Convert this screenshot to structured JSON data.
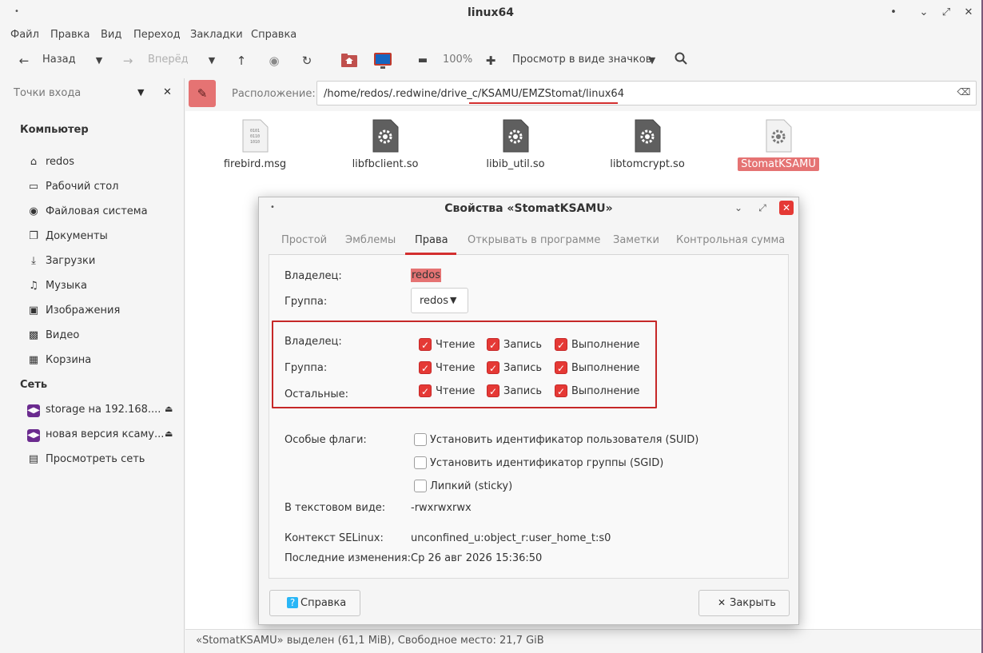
{
  "window": {
    "title": "linux64",
    "controls": {
      "keep_above": "•",
      "menu": "˅",
      "minimize": "˅",
      "maximize": "˄",
      "close": "✕"
    }
  },
  "menubar": [
    "Файл",
    "Правка",
    "Вид",
    "Переход",
    "Закладки",
    "Справка"
  ],
  "toolbar": {
    "back": "Назад",
    "forward": "Вперёд",
    "zoom": "100%",
    "view_mode": "Просмотр в виде значков"
  },
  "sidebar": {
    "header": "Точки входа",
    "computer_section": "Компьютер",
    "computer_items": [
      {
        "label": "redos",
        "icon": "home-icon"
      },
      {
        "label": "Рабочий стол",
        "icon": "desktop-icon"
      },
      {
        "label": "Файловая система",
        "icon": "filesystem-icon"
      },
      {
        "label": "Документы",
        "icon": "documents-icon"
      },
      {
        "label": "Загрузки",
        "icon": "downloads-icon"
      },
      {
        "label": "Музыка",
        "icon": "music-icon"
      },
      {
        "label": "Изображения",
        "icon": "pictures-icon"
      },
      {
        "label": "Видео",
        "icon": "video-icon"
      },
      {
        "label": "Корзина",
        "icon": "trash-icon"
      }
    ],
    "network_section": "Сеть",
    "network_items": [
      {
        "label": "storage на 192.168....",
        "icon": "network-share-icon",
        "eject": true
      },
      {
        "label": "новая версия ксаму...",
        "icon": "network-share-icon",
        "eject": true
      },
      {
        "label": "Просмотреть сеть",
        "icon": "browse-network-icon",
        "eject": false
      }
    ]
  },
  "location": {
    "label": "Расположение:",
    "path": "/home/redos/.redwine/drive_c/KSAMU/EMZStomat/linux64"
  },
  "files": [
    {
      "name": "firebird.msg",
      "type": "binary",
      "selected": false
    },
    {
      "name": "libfbclient.so",
      "type": "library",
      "selected": false
    },
    {
      "name": "libib_util.so",
      "type": "library",
      "selected": false
    },
    {
      "name": "libtomcrypt.so",
      "type": "library",
      "selected": false
    },
    {
      "name": "StomatKSAMU",
      "type": "executable",
      "selected": true
    }
  ],
  "statusbar": "«StomatKSAMU» выделен (61,1 MiB), Свободное место: 21,7 GiB",
  "dialog": {
    "title": "Свойства «StomatKSAMU»",
    "tabs": [
      "Простой",
      "Эмблемы",
      "Права",
      "Открывать в программе",
      "Заметки",
      "Контрольная сумма"
    ],
    "active_tab": "Права",
    "owner_label": "Владелец:",
    "owner_value": "redos",
    "group_label": "Группа:",
    "group_value": "redos",
    "permissions": [
      {
        "who": "Владелец:",
        "read": true,
        "write": true,
        "exec": true
      },
      {
        "who": "Группа:",
        "read": true,
        "write": true,
        "exec": true
      },
      {
        "who": "Остальные:",
        "read": true,
        "write": true,
        "exec": true
      }
    ],
    "perm_labels": {
      "read": "Чтение",
      "write": "Запись",
      "exec": "Выполнение"
    },
    "special_label": "Особые флаги:",
    "special_flags": [
      {
        "label": "Установить идентификатор пользователя (SUID)",
        "checked": false
      },
      {
        "label": "Установить идентификатор группы (SGID)",
        "checked": false
      },
      {
        "label": "Липкий (sticky)",
        "checked": false
      }
    ],
    "text_view_label": "В текстовом виде:",
    "text_view_value": "-rwxrwxrwx",
    "selinux_label": "Контекст SELinux:",
    "selinux_value": "unconfined_u:object_r:user_home_t:s0",
    "modified_label": "Последние изменения:",
    "modified_value": "Ср 26 авг 2026 15:36:50",
    "help_button": "Справка",
    "close_button": "Закрыть"
  },
  "colors": {
    "accent": "#e57373",
    "checkbox": "#e53935",
    "highlight_border": "#c62828"
  }
}
